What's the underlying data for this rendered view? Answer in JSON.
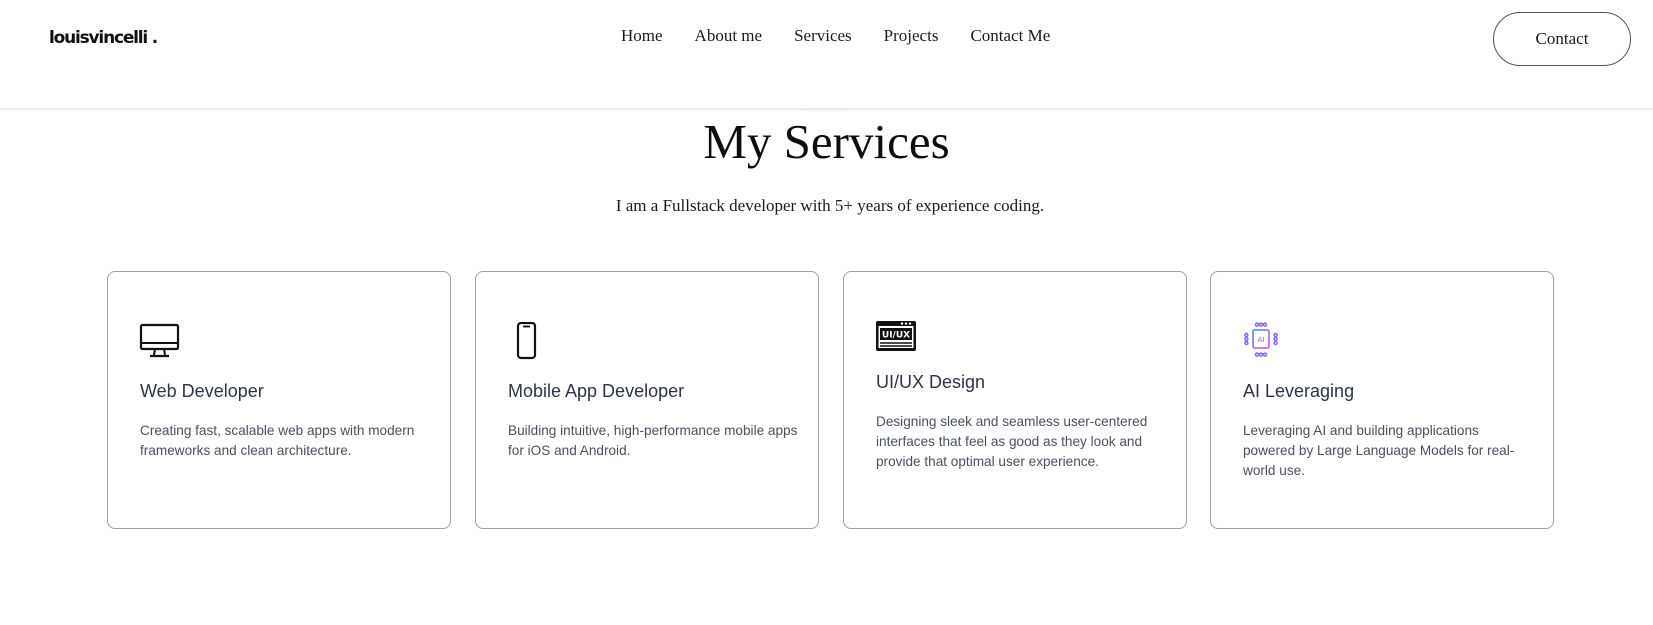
{
  "logo": "louisvincelli .",
  "nav": {
    "links": [
      "Home",
      "About me",
      "Services",
      "Projects",
      "Contact Me"
    ],
    "contact_button": "Contact"
  },
  "services": {
    "title": "My Services",
    "subtitle": "I am a Fullstack developer with 5+ years of experience coding.",
    "cards": [
      {
        "icon": "desktop-monitor-icon",
        "title": "Web Developer",
        "description": "Creating fast, scalable web apps with modern frameworks and clean architecture."
      },
      {
        "icon": "smartphone-icon",
        "title": "Mobile App Developer",
        "description": "Building intuitive, high-performance mobile apps for iOS and Android."
      },
      {
        "icon": "ui-ux-window-icon",
        "icon_text": "UI/UX",
        "title": "UI/UX Design",
        "description": "Designing sleek and seamless user-centered interfaces that feel as good as they look and provide that optimal user experience."
      },
      {
        "icon": "ai-chip-icon",
        "icon_text": "AI",
        "title": "AI Leveraging",
        "description": "Leveraging AI and building applications powered by Large Language Models for real-world use."
      }
    ]
  },
  "colors": {
    "card_border": "#a0a0a8",
    "card_title": "#2c3446",
    "card_text": "#4a5060",
    "ai_icon_gradient_start": "#3b82f6",
    "ai_icon_gradient_end": "#d946ef"
  }
}
